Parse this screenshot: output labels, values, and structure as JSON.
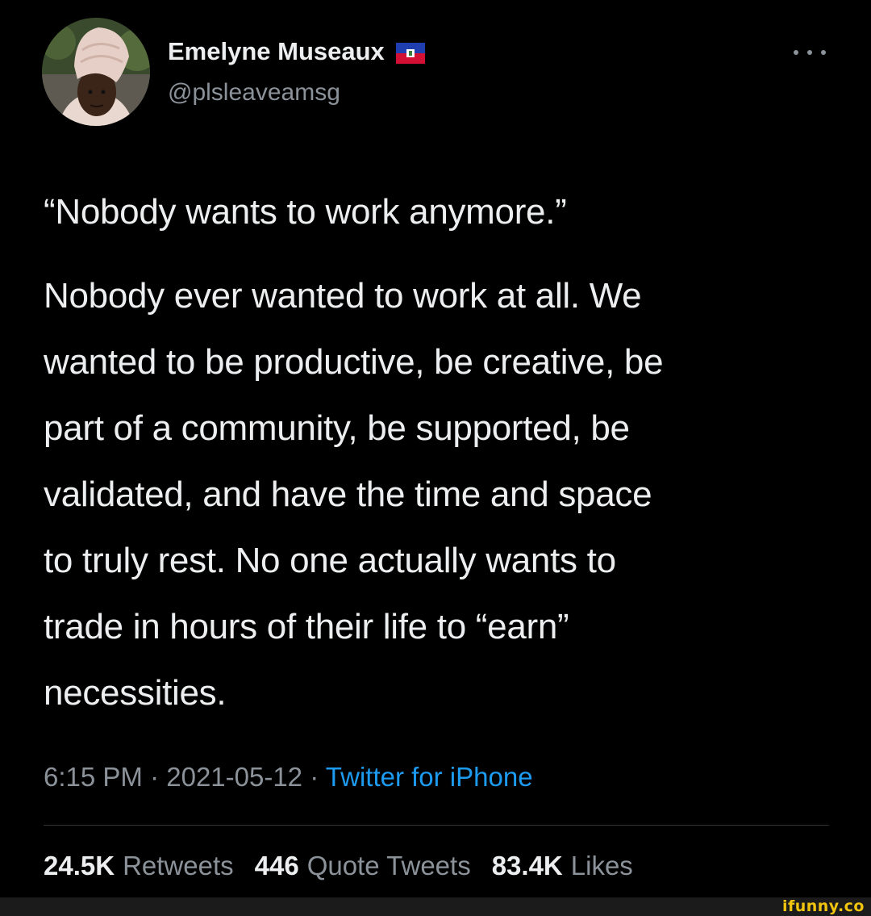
{
  "user": {
    "display_name": "Emelyne Museaux",
    "handle": "@plsleaveamsg",
    "flag_icon": "haiti-flag-icon",
    "avatar_icon": "profile-photo"
  },
  "more_icon": "more-options-icon",
  "tweet": {
    "paragraph1": "“Nobody wants to work anymore.”",
    "paragraph2": "Nobody ever wanted to work at all. We\nwanted to be productive, be creative, be\npart of a community, be supported, be\nvalidated, and have the time and space\nto truly rest. No one actually wants to\ntrade in hours of their life to “earn”\nnecessities."
  },
  "meta": {
    "time": "6:15 PM",
    "separator": " · ",
    "date": "2021-05-12",
    "source": "Twitter for iPhone"
  },
  "stats": {
    "retweets_count": "24.5K",
    "retweets_label": "Retweets",
    "quotes_count": "446",
    "quotes_label": "Quote Tweets",
    "likes_count": "83.4K",
    "likes_label": "Likes"
  },
  "watermark": "ifunny.co",
  "colors": {
    "background": "#000000",
    "text": "#eceeef",
    "secondary": "#8b9299",
    "link": "#1d9bf0",
    "divider": "#2f3336",
    "watermark": "#f1c40f"
  }
}
